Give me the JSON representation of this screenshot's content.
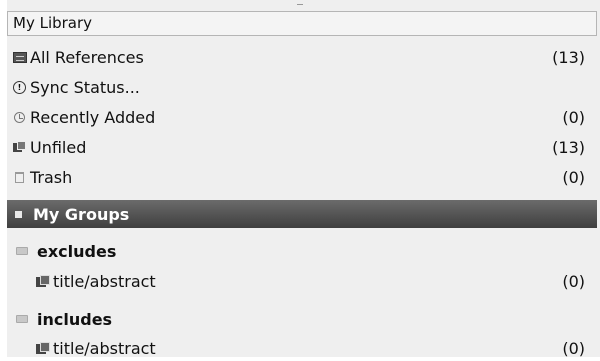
{
  "library": {
    "title": "My Library"
  },
  "library_items": [
    {
      "label": "All References",
      "count": "(13)",
      "icon": "references-icon"
    },
    {
      "label": "Sync Status...",
      "count": "",
      "icon": "sync-status-icon"
    },
    {
      "label": "Recently Added",
      "count": "(0)",
      "icon": "clock-icon"
    },
    {
      "label": "Unfiled",
      "count": "(13)",
      "icon": "unfiled-icon"
    },
    {
      "label": "Trash",
      "count": "(0)",
      "icon": "trash-icon"
    }
  ],
  "groups": {
    "title": "My Groups",
    "items": [
      {
        "label": "excludes",
        "children": [
          {
            "label": "title/abstract",
            "count": "(0)"
          }
        ]
      },
      {
        "label": "includes",
        "children": [
          {
            "label": "title/abstract",
            "count": "(0)"
          }
        ]
      }
    ]
  },
  "colors": {
    "groups_bar": "#4a4a4a",
    "panel_bg": "#efefef"
  }
}
